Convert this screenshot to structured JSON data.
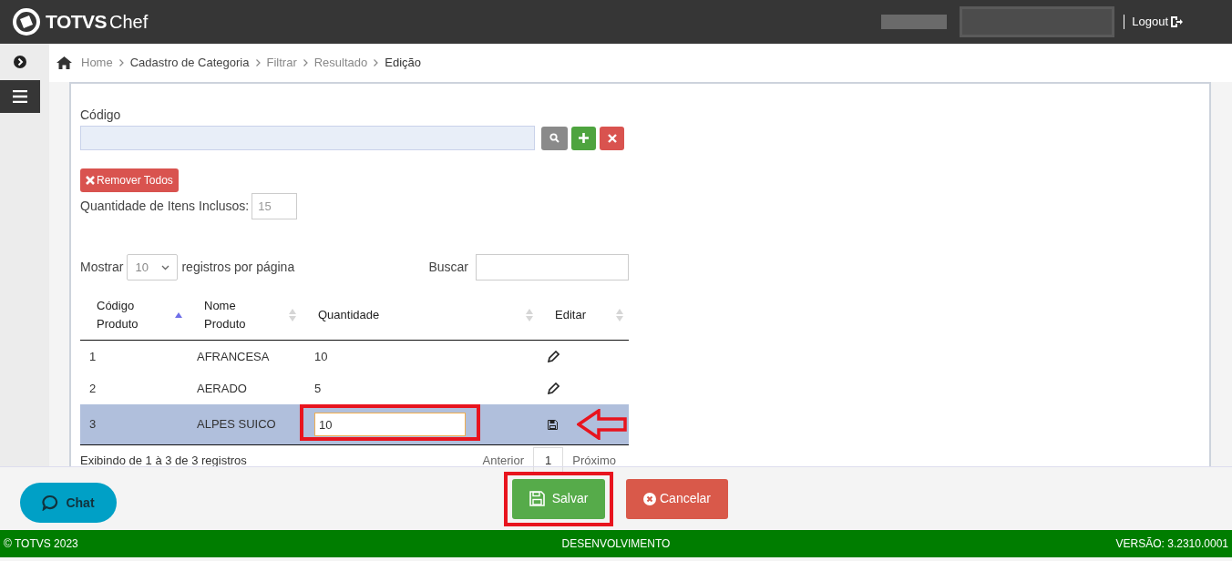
{
  "header": {
    "brand": "TOTVS",
    "product": "Chef",
    "logout": "Logout"
  },
  "breadcrumb": [
    {
      "label": "Home",
      "current": false
    },
    {
      "label": "Cadastro de Categoria",
      "current": false
    },
    {
      "label": "Filtrar",
      "current": false
    },
    {
      "label": "Resultado",
      "current": false
    },
    {
      "label": "Edição",
      "current": true
    }
  ],
  "form": {
    "code_label": "Código",
    "remove_all": "Remover Todos",
    "count_label": "Quantidade de Itens Inclusos:",
    "count_value": "15"
  },
  "table_controls": {
    "show_label": "Mostrar",
    "page_size": "10",
    "per_page_label": "registros por página",
    "search_label": "Buscar"
  },
  "table": {
    "columns": [
      {
        "label": "Código Produto",
        "sorted": true
      },
      {
        "label": "Nome Produto",
        "sorted": false
      },
      {
        "label": "Quantidade",
        "sorted": false
      },
      {
        "label": "Editar",
        "sorted": false
      }
    ],
    "rows": [
      {
        "code": "1",
        "name": "AFRANCESA",
        "quantity": "10",
        "selected": false,
        "editing": false
      },
      {
        "code": "2",
        "name": "AERADO",
        "quantity": "5",
        "selected": false,
        "editing": false
      },
      {
        "code": "3",
        "name": "ALPES SUICO",
        "quantity": "10",
        "selected": true,
        "editing": true
      }
    ]
  },
  "pager": {
    "info": "Exibindo de 1 à 3 de 3 registros",
    "previous": "Anterior",
    "page": "1",
    "next": "Próximo"
  },
  "actions": {
    "save": "Salvar",
    "cancel": "Cancelar"
  },
  "chat": "Chat",
  "footer": {
    "copyright": "© TOTVS 2023",
    "environment": "DESENVOLVIMENTO",
    "version": "VERSÃO: 3.2310.0001"
  }
}
